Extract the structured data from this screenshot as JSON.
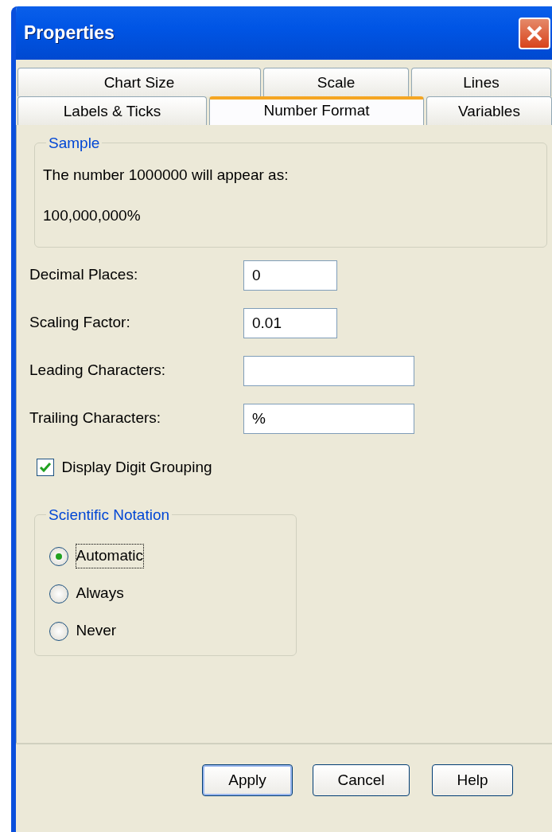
{
  "window": {
    "title": "Properties"
  },
  "tab_rows": [
    {
      "tabs": [
        {
          "label": "Chart Size",
          "selected": false
        },
        {
          "label": "Scale",
          "selected": false
        },
        {
          "label": "Lines",
          "selected": false
        }
      ]
    },
    {
      "tabs": [
        {
          "label": "Labels & Ticks",
          "selected": false
        },
        {
          "label": "Number Format",
          "selected": true
        },
        {
          "label": "Variables",
          "selected": false
        }
      ]
    }
  ],
  "sample": {
    "legend": "Sample",
    "description": "The number 1000000 will appear as:",
    "result": "100,000,000%"
  },
  "fields": [
    {
      "label": "Decimal Places:",
      "value": "0",
      "kind": "short"
    },
    {
      "label": "Scaling Factor:",
      "value": "0.01",
      "kind": "short"
    },
    {
      "label": "Leading Characters:",
      "kind": "long"
    },
    {
      "label": "Trailing Characters:",
      "value": "%",
      "kind": "long"
    }
  ],
  "digit_grouping": {
    "label": "Display Digit Grouping",
    "checked": true
  },
  "scientific_notation": {
    "legend": "Scientific Notation",
    "options": [
      {
        "label": "Automatic",
        "selected": true,
        "focused": true
      },
      {
        "label": "Always",
        "selected": false,
        "focused": false
      },
      {
        "label": "Never",
        "selected": false,
        "focused": false
      }
    ]
  },
  "buttons": [
    {
      "label": "Apply",
      "default": true
    },
    {
      "label": "Cancel",
      "default": false
    },
    {
      "label": "Help",
      "default": false
    }
  ]
}
